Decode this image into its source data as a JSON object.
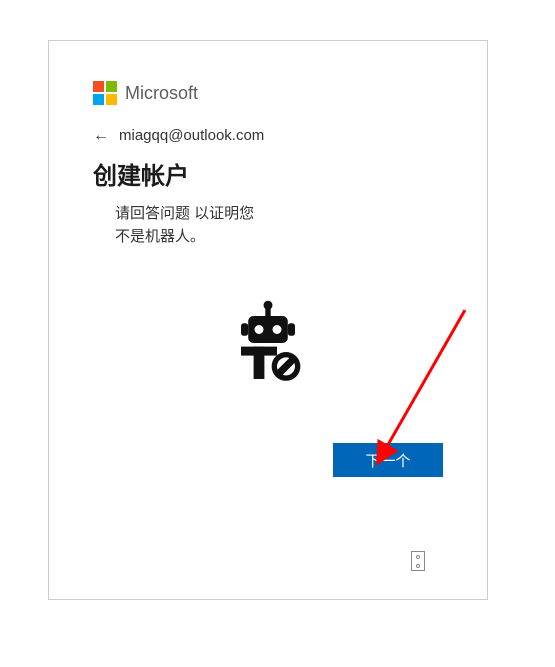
{
  "brand": {
    "name": "Microsoft"
  },
  "identity": {
    "email": "miagqq@outlook.com"
  },
  "page": {
    "title": "创建帐户",
    "instruction_line1": "请回答问题 以证明您",
    "instruction_line2": "不是机器人。"
  },
  "actions": {
    "next": "下一个"
  }
}
